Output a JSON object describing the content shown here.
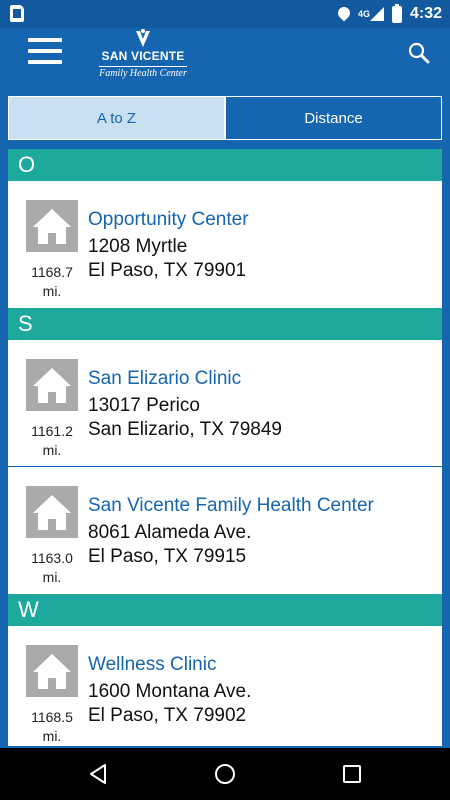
{
  "status_bar": {
    "time": "4:32",
    "network": "4G",
    "icons": [
      "sim-card-icon",
      "location-icon",
      "signal-icon",
      "battery-icon"
    ]
  },
  "header": {
    "logo_name": "SAN VICENTE",
    "logo_sub": "Family Health Center",
    "icons": [
      "menu-icon",
      "search-icon"
    ]
  },
  "tabs": [
    {
      "label": "A to Z",
      "selected": true
    },
    {
      "label": "Distance",
      "selected": false
    }
  ],
  "sections": [
    {
      "letter": "O",
      "items": [
        {
          "name": "Opportunity Center",
          "address1": "1208 Myrtle",
          "address2": "El Paso, TX 79901",
          "distance": "1168.7",
          "unit": "mi."
        }
      ]
    },
    {
      "letter": "S",
      "items": [
        {
          "name": "San Elizario Clinic",
          "address1": "13017 Perico",
          "address2": "San Elizario, TX 79849",
          "distance": "1161.2",
          "unit": "mi."
        },
        {
          "name": "San Vicente Family Health Center",
          "address1": "8061 Alameda Ave.",
          "address2": "El Paso, TX 79915",
          "distance": "1163.0",
          "unit": "mi."
        }
      ]
    },
    {
      "letter": "W",
      "items": [
        {
          "name": "Wellness Clinic",
          "address1": "1600 Montana Ave.",
          "address2": "El Paso, TX 79902",
          "distance": "1168.5",
          "unit": "mi."
        }
      ]
    }
  ],
  "nav_bar": {
    "icons": [
      "back-icon",
      "home-icon",
      "recents-icon"
    ]
  },
  "colors": {
    "brand_blue": "#1565b0",
    "section_teal": "#1ea99e",
    "tab_selected_bg": "#c9e0f0",
    "house_gray": "#aaaaaa"
  }
}
